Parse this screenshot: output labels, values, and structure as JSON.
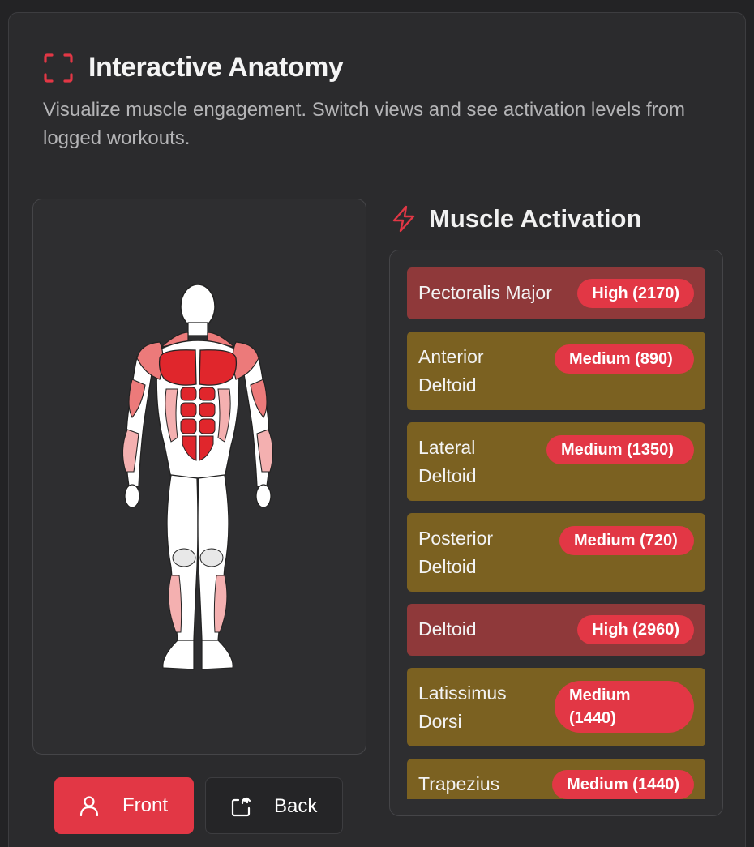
{
  "header": {
    "icon": "scan-frame-icon",
    "title": "Interactive Anatomy",
    "subtitle": "Visualize muscle engagement. Switch views and see activation levels from logged workouts."
  },
  "views": {
    "front_label": "Front",
    "back_label": "Back",
    "active": "Front"
  },
  "activation": {
    "icon": "lightning-bolt-icon",
    "title": "Muscle Activation",
    "items": [
      {
        "name": "Pectoralis Major",
        "level": "High (2170)",
        "type": "high"
      },
      {
        "name": "Anterior Deltoid",
        "level": "Medium (890)",
        "type": "medium"
      },
      {
        "name": "Lateral Deltoid",
        "level": "Medium (1350)",
        "type": "medium"
      },
      {
        "name": "Posterior Deltoid",
        "level": "Medium (720)",
        "type": "medium"
      },
      {
        "name": "Deltoid",
        "level": "High (2960)",
        "type": "high"
      },
      {
        "name": "Latissimus Dorsi",
        "level": "Medium (1440)",
        "type": "medium"
      },
      {
        "name": "Trapezius",
        "level": "Medium (1440)",
        "type": "medium"
      }
    ]
  },
  "colors": {
    "accent": "#e23745",
    "high_bg": "#8f393a",
    "medium_bg": "#7b6121",
    "panel_bg": "#2e2e30"
  }
}
